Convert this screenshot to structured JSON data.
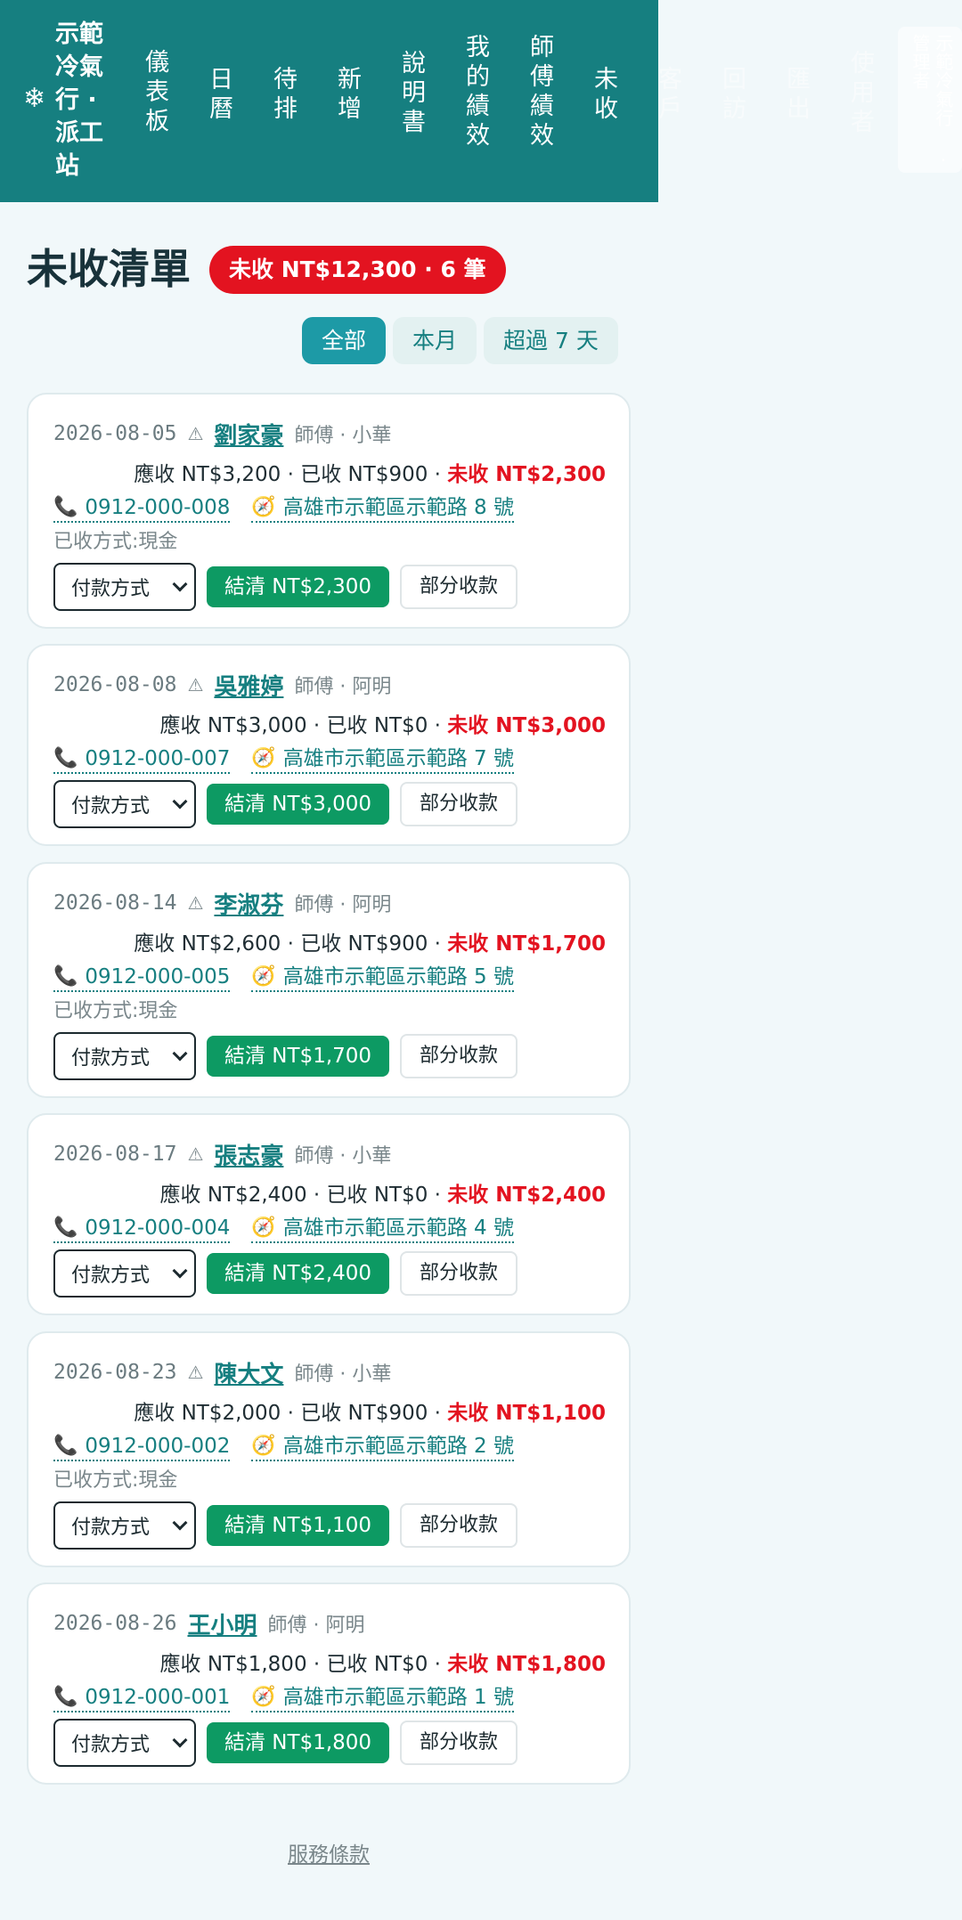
{
  "nav": {
    "brand_icon": "snowflake-icon",
    "brand_name": "示範冷氣行 · 派工站",
    "items": [
      {
        "label": "儀表板"
      },
      {
        "label": "日曆"
      },
      {
        "label": "待排"
      },
      {
        "label": "新增"
      },
      {
        "label": "說明書"
      },
      {
        "label": "我的績效"
      },
      {
        "label": "師傅績效"
      },
      {
        "label": "未收"
      },
      {
        "label": "客戶"
      },
      {
        "label": "回訪"
      },
      {
        "label": "匯出"
      },
      {
        "label": "使用者"
      }
    ],
    "overflow_chip": "示範冷氣行 · 管理者"
  },
  "header": {
    "title": "未收清單",
    "summary_badge": "未收 NT$12,300 · 6 筆"
  },
  "filters": [
    {
      "label": "全部",
      "active": true
    },
    {
      "label": "本月",
      "active": false
    },
    {
      "label": "超過 7 天",
      "active": false
    }
  ],
  "cards": [
    {
      "date": "2026-08-05",
      "warning": "⚠",
      "customer": "劉家豪",
      "technician": "師傅 · 小華",
      "due": "應收 NT$3,200",
      "paid": "已收 NT$900",
      "owed": "未收 NT$2,300",
      "phone": "0912-000-008",
      "address": "高雄市示範區示範路 8 號",
      "paid_method": "已收方式:現金",
      "payment_select": "付款方式",
      "settle_label": "結清 NT$2,300",
      "partial_label": "部分收款"
    },
    {
      "date": "2026-08-08",
      "warning": "⚠",
      "customer": "吳雅婷",
      "technician": "師傅 · 阿明",
      "due": "應收 NT$3,000",
      "paid": "已收 NT$0",
      "owed": "未收 NT$3,000",
      "phone": "0912-000-007",
      "address": "高雄市示範區示範路 7 號",
      "paid_method": "",
      "payment_select": "付款方式",
      "settle_label": "結清 NT$3,000",
      "partial_label": "部分收款"
    },
    {
      "date": "2026-08-14",
      "warning": "⚠",
      "customer": "李淑芬",
      "technician": "師傅 · 阿明",
      "due": "應收 NT$2,600",
      "paid": "已收 NT$900",
      "owed": "未收 NT$1,700",
      "phone": "0912-000-005",
      "address": "高雄市示範區示範路 5 號",
      "paid_method": "已收方式:現金",
      "payment_select": "付款方式",
      "settle_label": "結清 NT$1,700",
      "partial_label": "部分收款"
    },
    {
      "date": "2026-08-17",
      "warning": "⚠",
      "customer": "張志豪",
      "technician": "師傅 · 小華",
      "due": "應收 NT$2,400",
      "paid": "已收 NT$0",
      "owed": "未收 NT$2,400",
      "phone": "0912-000-004",
      "address": "高雄市示範區示範路 4 號",
      "paid_method": "",
      "payment_select": "付款方式",
      "settle_label": "結清 NT$2,400",
      "partial_label": "部分收款"
    },
    {
      "date": "2026-08-23",
      "warning": "⚠",
      "customer": "陳大文",
      "technician": "師傅 · 小華",
      "due": "應收 NT$2,000",
      "paid": "已收 NT$900",
      "owed": "未收 NT$1,100",
      "phone": "0912-000-002",
      "address": "高雄市示範區示範路 2 號",
      "paid_method": "已收方式:現金",
      "payment_select": "付款方式",
      "settle_label": "結清 NT$1,100",
      "partial_label": "部分收款"
    },
    {
      "date": "2026-08-26",
      "warning": "",
      "customer": "王小明",
      "technician": "師傅 · 阿明",
      "due": "應收 NT$1,800",
      "paid": "已收 NT$0",
      "owed": "未收 NT$1,800",
      "phone": "0912-000-001",
      "address": "高雄市示範區示範路 1 號",
      "paid_method": "",
      "payment_select": "付款方式",
      "settle_label": "結清 NT$1,800",
      "partial_label": "部分收款"
    }
  ],
  "footer": {
    "terms_link": "服務條款"
  },
  "colors": {
    "nav_bg": "#167f80",
    "accent": "#1d9aa6",
    "danger": "#e31320",
    "success": "#0d9a63",
    "page_bg": "#f1f8fa"
  },
  "icons": {
    "phone": "phone-icon",
    "navigate": "compass-icon",
    "warning": "warning-icon"
  }
}
